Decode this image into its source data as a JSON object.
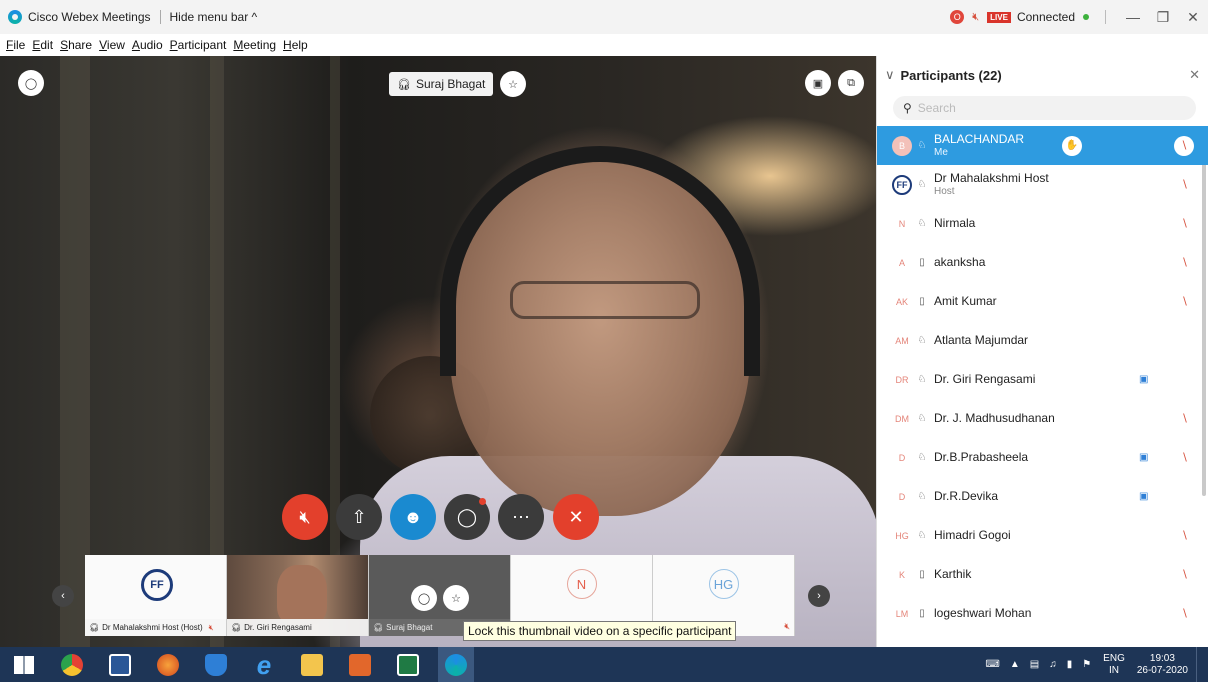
{
  "app": {
    "title": "Cisco Webex Meetings",
    "hide_menu": "Hide menu bar ^",
    "recording_badge": "O",
    "live_badge": "LIVE",
    "status": "Connected"
  },
  "menu": [
    {
      "key": "F",
      "rest": "ile"
    },
    {
      "key": "E",
      "rest": "dit"
    },
    {
      "key": "S",
      "rest": "hare"
    },
    {
      "key": "V",
      "rest": "iew"
    },
    {
      "key": "A",
      "rest": "udio"
    },
    {
      "key": "P",
      "rest": "articipant"
    },
    {
      "key": "M",
      "rest": "eeting"
    },
    {
      "key": "H",
      "rest": "elp"
    }
  ],
  "video": {
    "speaker_name": "Suraj Bhagat"
  },
  "thumbnails": [
    {
      "label": "Dr Mahalakshmi Host (Host)",
      "type": "logo"
    },
    {
      "label": "Dr. Giri Rengasami",
      "type": "photo"
    },
    {
      "label": "Suraj Bhagat",
      "type": "active"
    },
    {
      "label": "",
      "type": "avatar",
      "initials": "N"
    },
    {
      "label": "",
      "type": "avatar",
      "initials": "HG"
    }
  ],
  "tooltip": "Lock this thumbnail video on a specific participant",
  "participants_panel": {
    "title": "Participants (22)",
    "search_placeholder": "Search",
    "rows": [
      {
        "initials": "B",
        "name": "BALACHANDAR",
        "sub": "Me",
        "device": "headset",
        "muted": true,
        "video": false,
        "selected": true,
        "hand": true
      },
      {
        "initials": "",
        "name": "Dr Mahalakshmi Host",
        "sub": "Host",
        "device": "headset",
        "muted": true,
        "video": false,
        "logo": true
      },
      {
        "initials": "N",
        "name": "Nirmala",
        "sub": "",
        "device": "headset",
        "muted": true,
        "video": false,
        "presence": true
      },
      {
        "initials": "A",
        "name": "akanksha",
        "sub": "",
        "device": "phone",
        "muted": true,
        "video": false
      },
      {
        "initials": "AK",
        "name": "Amit Kumar",
        "sub": "",
        "device": "phone",
        "muted": true,
        "video": false
      },
      {
        "initials": "AM",
        "name": "Atlanta Majumdar",
        "sub": "",
        "device": "headset",
        "muted": false,
        "video": false
      },
      {
        "initials": "DR",
        "name": "Dr. Giri Rengasami",
        "sub": "",
        "device": "headset",
        "muted": false,
        "video": true
      },
      {
        "initials": "DM",
        "name": "Dr. J. Madhusudhanan",
        "sub": "",
        "device": "headset",
        "muted": true,
        "video": false
      },
      {
        "initials": "D",
        "name": "Dr.B.Prabasheela",
        "sub": "",
        "device": "headset",
        "muted": true,
        "video": true
      },
      {
        "initials": "D",
        "name": "Dr.R.Devika",
        "sub": "",
        "device": "headset",
        "muted": false,
        "video": true
      },
      {
        "initials": "HG",
        "name": "Himadri Gogoi",
        "sub": "",
        "device": "headset",
        "muted": true,
        "video": false
      },
      {
        "initials": "K",
        "name": "Karthik",
        "sub": "",
        "device": "phone",
        "muted": true,
        "video": false
      },
      {
        "initials": "LM",
        "name": "logeshwari Mohan",
        "sub": "",
        "device": "phone",
        "muted": true,
        "video": false
      }
    ]
  },
  "taskbar": {
    "lang_top": "ENG",
    "lang_bottom": "IN",
    "time": "19:03",
    "date": "26-07-2020"
  },
  "colors": {
    "accent": "#2e9be0",
    "end_call": "#e3402c",
    "muted_icon": "#d6503d",
    "taskbar": "#1e3556"
  }
}
